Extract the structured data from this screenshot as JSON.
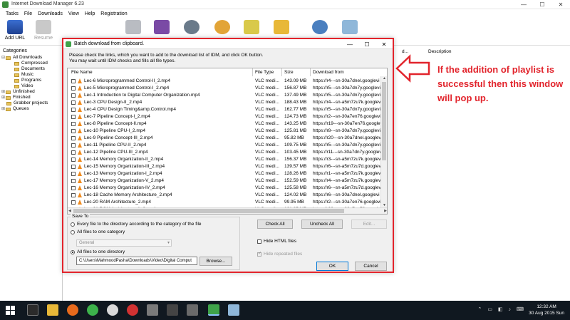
{
  "app": {
    "title": "Internet Download Manager 6.23",
    "window_buttons": [
      "—",
      "☐",
      "✕"
    ],
    "menu": [
      "Tasks",
      "File",
      "Downloads",
      "View",
      "Help",
      "Registration"
    ]
  },
  "toolbar": {
    "add_url": "Add URL",
    "resume": "Resume",
    "icons": [
      "add-url-icon",
      "resume-icon",
      "stop-icon",
      "stop-all-icon",
      "delete-icon",
      "delete-completed-icon",
      "options-icon",
      "scheduler-icon",
      "start-queue-icon",
      "stop-queue-icon",
      "grabber-icon",
      "tell-a-friend-icon"
    ]
  },
  "categories": {
    "header": "Categories",
    "items": [
      "All Downloads",
      "Compressed",
      "Documents",
      "Music",
      "Programs",
      "Video",
      "Unfinished",
      "Finished",
      "Grabber projects",
      "Queues"
    ]
  },
  "list": {
    "col_date": "d...",
    "col_desc": "Description"
  },
  "dialog": {
    "title": "Batch download from clipboard.",
    "window_buttons": [
      "—",
      "☐",
      "✕"
    ],
    "instruction1": "Please check the links, which you want to add to the download list of IDM, and click OK button.",
    "instruction2": "You may wait until IDM checks and fills all file types.",
    "columns": {
      "name": "File Name",
      "type": "File Type",
      "size": "Size",
      "from": "Download from"
    },
    "files": [
      {
        "name": "Lec-6 Microprogrammed Control-II_2.mp4",
        "type": "VLC medi...",
        "size": "143.09  MB",
        "from": "https://r4---sn-30a7dnel.googlevi"
      },
      {
        "name": "Lec-5 Microprogrammed Control-I_2.mp4",
        "type": "VLC medi...",
        "size": "156.87  MB",
        "from": "https://r5---sn-30a7dn7y.googlevi"
      },
      {
        "name": "Lec-1 Introduction to Digital Computer Organization.mp4",
        "type": "VLC medi...",
        "size": "137.49  MB",
        "from": "https://r5---sn-30a7dn7y.googlevi"
      },
      {
        "name": "Lec-3 CPU Design-II_2.mp4",
        "type": "VLC medi...",
        "size": "188.43  MB",
        "from": "https://r4---sn-a5m7zu7k.googlevi"
      },
      {
        "name": "Lec-4 CPU Design Timing&amp;Control.mp4",
        "type": "VLC medi...",
        "size": "162.77  MB",
        "from": "https://r5---sn-30a7dn7y.googlevi"
      },
      {
        "name": "Lec-7 Pipeline Concept-I_2.mp4",
        "type": "VLC medi...",
        "size": "124.73  MB",
        "from": "https://r2---sn-30a7en76.googlevi"
      },
      {
        "name": "Lec-8 Pipeline Concept-II.mp4",
        "type": "VLC medi...",
        "size": "143.25  MB",
        "from": "https://r19---sn-30a7en76.googlev"
      },
      {
        "name": "Lec-10 Pipeline CPU-I_2.mp4",
        "type": "VLC medi...",
        "size": "125.81  MB",
        "from": "https://r8---sn-30a7dn7y.googlevi"
      },
      {
        "name": "Lec-9 Pipeline Concept-III_2.mp4",
        "type": "VLC medi...",
        "size": "95.82  MB",
        "from": "https://r20---sn-30a7dnel.googlev"
      },
      {
        "name": "Lec-11 Pipeline CPU-II_2.mp4",
        "type": "VLC medi...",
        "size": "109.75  MB",
        "from": "https://r5---sn-30a7dn7y.googlevi"
      },
      {
        "name": "Lec-12 Pipeline CPU-III_2.mp4",
        "type": "VLC medi...",
        "size": "103.45  MB",
        "from": "https://r11---sn-30a7dn7y.googlev"
      },
      {
        "name": "Lec-14 Memory Organization-II_2.mp4",
        "type": "VLC medi...",
        "size": "156.37  MB",
        "from": "https://r3---sn-a5m7zu7k.googlevi"
      },
      {
        "name": "Lec-15 Memory Organization-III_2.mp4",
        "type": "VLC medi...",
        "size": "139.57  MB",
        "from": "https://r6---sn-a5m7zu7d.googlevi"
      },
      {
        "name": "Lec-13 Memory Organization-I_2.mp4",
        "type": "VLC medi...",
        "size": "128.26  MB",
        "from": "https://r1---sn-a5m7zu7k.googlevi"
      },
      {
        "name": "Lec-17 Memory Organization-V_2.mp4",
        "type": "VLC medi...",
        "size": "152.59  MB",
        "from": "https://r4---sn-a5m7zu7k.googlevi"
      },
      {
        "name": "Lec-16 Memory Organization-IV_2.mp4",
        "type": "VLC medi...",
        "size": "125.58  MB",
        "from": "https://r6---sn-a5m7zu7d.googlevi"
      },
      {
        "name": "Lec-18 Cache Memory Architecture_2.mp4",
        "type": "VLC medi...",
        "size": "124.02  MB",
        "from": "https://r6---sn-30a7dnel.googlevi"
      },
      {
        "name": "Lec-20 RAM Architecture_2.mp4",
        "type": "VLC medi...",
        "size": "99.95  MB",
        "from": "https://r2---sn-30a7en76.googlevi"
      },
      {
        "name": "Lec-21 ROM Architecture-1_2.mp4",
        "type": "VLC medi...",
        "size": "121.85  MB",
        "from": "https://r20---sn-30a7en76.googlev"
      }
    ],
    "save_to": {
      "legend": "Save To",
      "opt_every": "Every file to the directory according to the category of the file",
      "opt_category": "All files to one category",
      "category_value": "General",
      "opt_directory": "All files to one directory",
      "path": "C:\\Users\\MahmoodPasha\\Downloads\\Video\\Digital Comput",
      "browse": "Browse..."
    },
    "buttons": {
      "check_all": "Check All",
      "uncheck_all": "Uncheck All",
      "edit": "Edit...",
      "ok": "OK",
      "cancel": "Cancel"
    },
    "hide_html": "Hide HTML files",
    "hide_repeated": "Hide repeated files"
  },
  "annotation": {
    "text": "If the addition of playlist is successful then this window will pop up.",
    "color": "#e2242c"
  },
  "taskbar": {
    "time": "12:32 AM",
    "date": "30 Aug 2015 Sun"
  }
}
